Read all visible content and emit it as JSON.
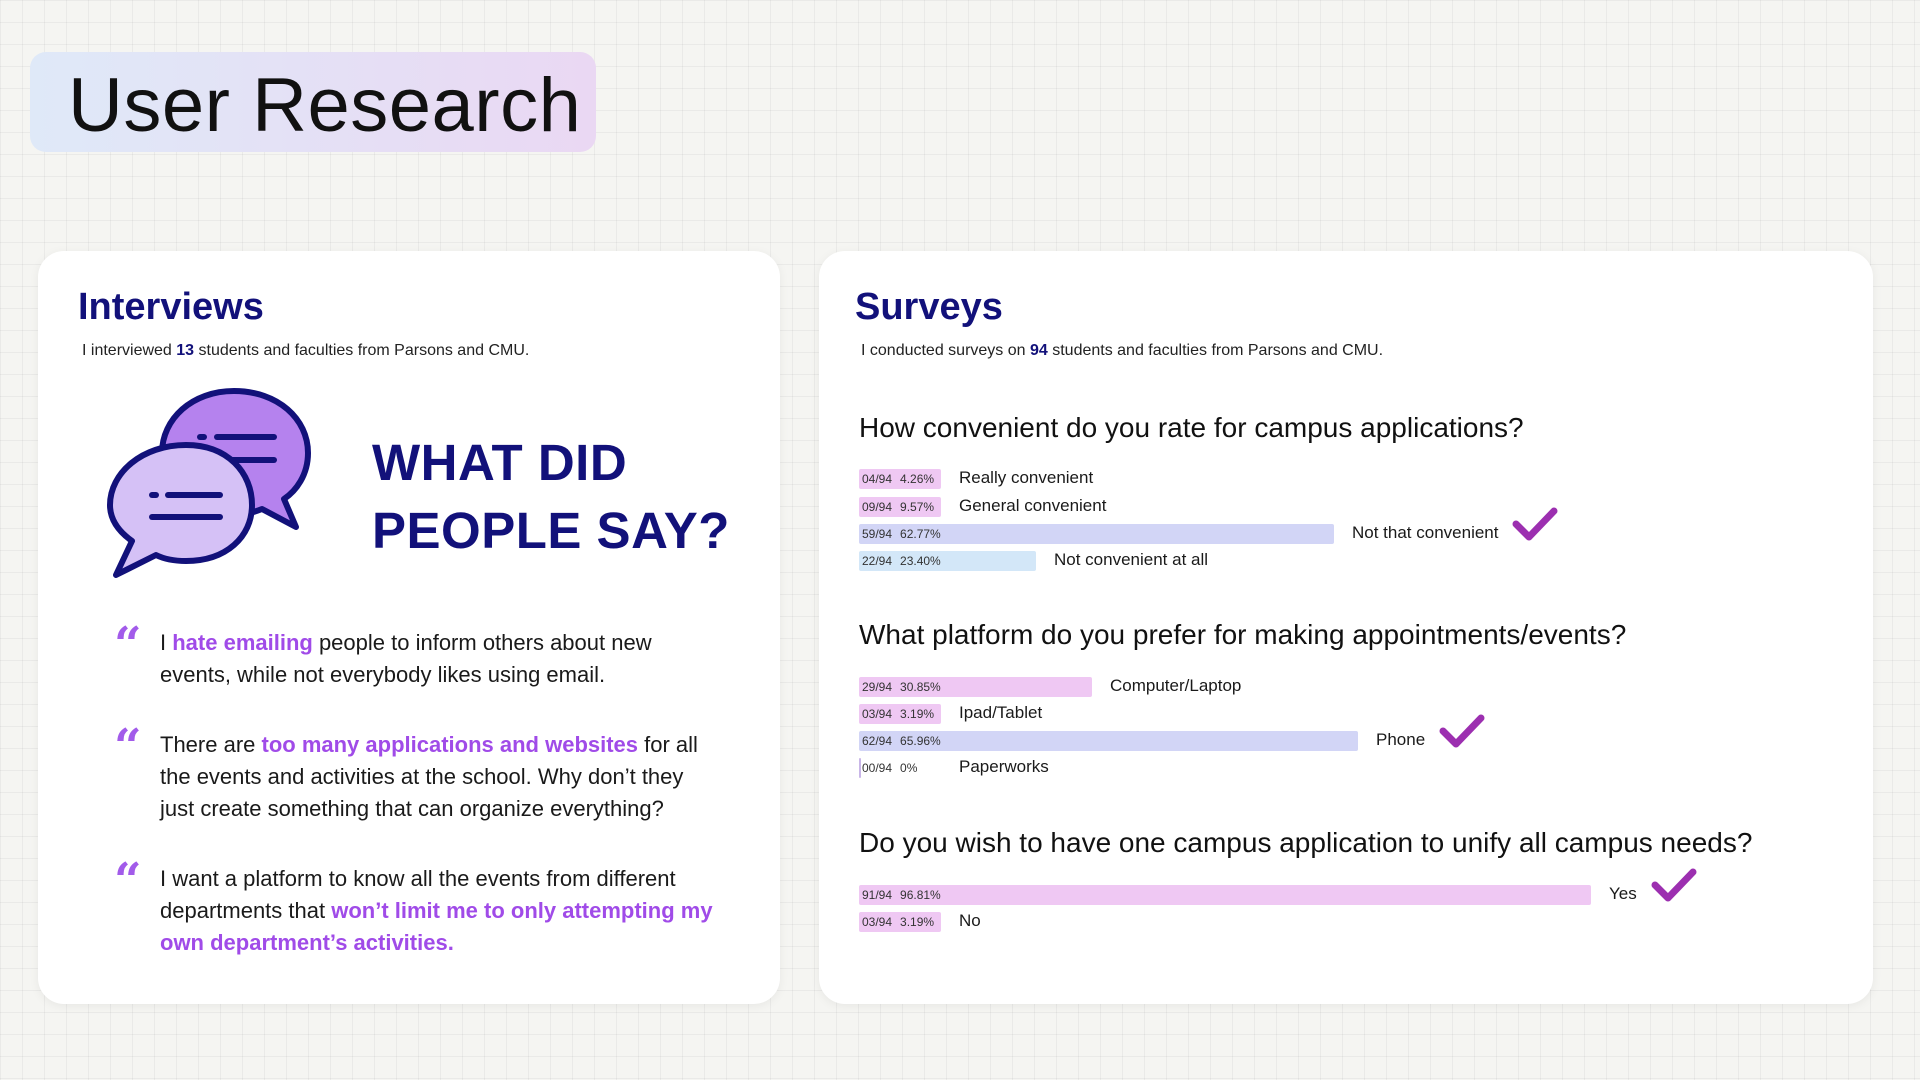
{
  "page_title": "User Research",
  "interviews": {
    "title": "Interviews",
    "sub_pre": "I interviewed ",
    "sub_num": "13",
    "sub_post": " students and faculties from Parsons and CMU.",
    "headline_1": "WHAT DID",
    "headline_2": "PEOPLE SAY?",
    "quotes": [
      {
        "pre": "I ",
        "hl": "hate emailing",
        "post": " people to inform others about new events, while not everybody likes using email."
      },
      {
        "pre": "There are ",
        "hl": "too many applications and websites",
        "post": " for all the events and activities at the school. Why don’t they just create something that can organize everything?"
      },
      {
        "pre": "I want a platform to know all the events from different departments that ",
        "hl": "won’t limit me to only attempting my own department’s activities.",
        "post": ""
      }
    ]
  },
  "surveys": {
    "title": "Surveys",
    "sub_pre": "I conducted surveys on ",
    "sub_num": "94",
    "sub_post": " students and faculties from Parsons and CMU.",
    "questions": [
      {
        "question": "How convenient do you rate for campus applications?",
        "options": [
          {
            "count": "04/94",
            "pct": "4.26%",
            "label": "Really convenient",
            "fraction": 0.0426,
            "color": "pink"
          },
          {
            "count": "09/94",
            "pct": "9.57%",
            "label": "General convenient",
            "fraction": 0.0957,
            "color": "pink"
          },
          {
            "count": "59/94",
            "pct": "62.77%",
            "label": "Not that convenient",
            "fraction": 0.6277,
            "color": "purple",
            "checked": true
          },
          {
            "count": "22/94",
            "pct": "23.40%",
            "label": "Not convenient at all",
            "fraction": 0.234,
            "color": "blue"
          }
        ]
      },
      {
        "question": "What platform do you prefer for making appointments/events?",
        "options": [
          {
            "count": "29/94",
            "pct": "30.85%",
            "label": "Computer/Laptop",
            "fraction": 0.3085,
            "color": "pink"
          },
          {
            "count": "03/94",
            "pct": "3.19%",
            "label": "Ipad/Tablet",
            "fraction": 0.0319,
            "color": "pink"
          },
          {
            "count": "62/94",
            "pct": "65.96%",
            "label": "Phone",
            "fraction": 0.6596,
            "color": "purple",
            "checked": true
          },
          {
            "count": "00/94",
            "pct": "0%",
            "label": "Paperworks",
            "fraction": 0,
            "color": "thin"
          }
        ]
      },
      {
        "question": "Do you wish to have one campus application to unify all campus needs?",
        "options": [
          {
            "count": "91/94",
            "pct": "96.81%",
            "label": "Yes",
            "fraction": 0.9681,
            "color": "pink",
            "checked": true
          },
          {
            "count": "03/94",
            "pct": "3.19%",
            "label": "No",
            "fraction": 0.0319,
            "color": "pink"
          }
        ]
      }
    ]
  },
  "colors": {
    "navy": "#12117a",
    "accent_purple": "#a04be8",
    "check_purple": "#9c2fb0",
    "bar_pink": "#efc8f3",
    "bar_purple": "#d2d5f6",
    "bar_blue": "#d3e7f8"
  },
  "icons": [
    "chat-bubbles-icon",
    "quote-mark-icon",
    "checkmark-icon"
  ]
}
